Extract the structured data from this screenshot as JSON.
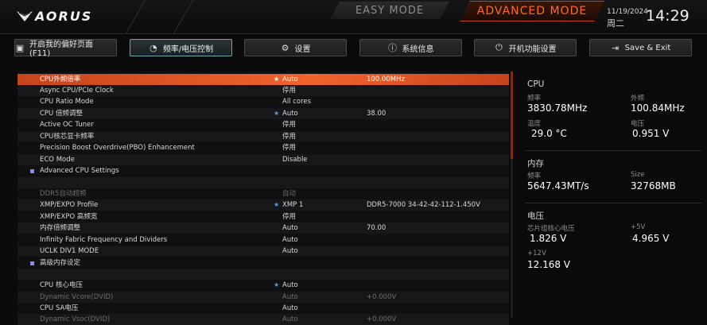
{
  "header": {
    "brand": "AORUS",
    "mode_easy": "EASY MODE",
    "mode_advanced": "ADVANCED MODE",
    "date": "11/19/2024",
    "weekday": "周二",
    "time": "14:29"
  },
  "tabs": [
    {
      "label": "开启我的偏好页面 (F11)",
      "icon": "folder-star-icon"
    },
    {
      "label": "频率/电压控制",
      "icon": "speedometer-icon"
    },
    {
      "label": "设置",
      "icon": "gear-icon"
    },
    {
      "label": "系统信息",
      "icon": "info-icon"
    },
    {
      "label": "开机功能设置",
      "icon": "power-icon"
    },
    {
      "label": "Save & Exit",
      "icon": "exit-icon"
    }
  ],
  "settings": [
    {
      "name": "CPU外频倍率",
      "value": "Auto",
      "value2": "100.00MHz",
      "star": true
    },
    {
      "name": "Async CPU/PCIe Clock",
      "value": "停用",
      "value2": ""
    },
    {
      "name": "CPU Ratio Mode",
      "value": "All cores",
      "value2": ""
    },
    {
      "name": "CPU 倍频调整",
      "value": "Auto",
      "value2": "38.00",
      "star": true
    },
    {
      "name": "Active OC Tuner",
      "value": "停用",
      "value2": ""
    },
    {
      "name": "CPU核芯显卡频率",
      "value": "停用",
      "value2": ""
    },
    {
      "name": "Precision Boost Overdrive(PBO) Enhancement",
      "value": "停用",
      "value2": ""
    },
    {
      "name": "ECO Mode",
      "value": "Disable",
      "value2": ""
    },
    {
      "name": "Advanced CPU Settings",
      "value": "",
      "value2": ""
    },
    {
      "name": "",
      "value": "",
      "value2": ""
    },
    {
      "name": "DDR5自动超频",
      "value": "自动",
      "value2": ""
    },
    {
      "name": "XMP/EXPO Profile",
      "value": "XMP 1",
      "value2": "DDR5-7000 34-42-42-112-1.450V",
      "star": true
    },
    {
      "name": "XMP/EXPO 高频宽",
      "value": "停用",
      "value2": ""
    },
    {
      "name": "内存倍频调整",
      "value": "Auto",
      "value2": "70.00"
    },
    {
      "name": "Infinity Fabric Frequency and Dividers",
      "value": "Auto",
      "value2": ""
    },
    {
      "name": "UCLK DIV1 MODE",
      "value": "Auto",
      "value2": ""
    },
    {
      "name": "高级内存设定",
      "value": "",
      "value2": ""
    },
    {
      "name": "",
      "value": "",
      "value2": ""
    },
    {
      "name": "CPU 核心电压",
      "value": "Auto",
      "value2": "",
      "star": true
    },
    {
      "name": "Dynamic Vcore(DVID)",
      "value": "Auto",
      "value2": "+0.000V"
    },
    {
      "name": "CPU SA电压",
      "value": "Auto",
      "value2": ""
    },
    {
      "name": "Dynamic Vsoc(DVID)",
      "value": "Auto",
      "value2": "+0.000V"
    }
  ],
  "info": {
    "cpu": {
      "title": "CPU",
      "freq_label": "频率",
      "freq": "3830.78MHz",
      "bclk_label": "外频",
      "bclk": "100.84MHz",
      "temp_label": "温度",
      "temp": "29.0 °C",
      "volt_label": "电压",
      "volt": "0.951 V"
    },
    "memory": {
      "title": "内存",
      "freq_label": "频率",
      "freq": "5647.43MT/s",
      "size_label": "Size",
      "size": "32768MB"
    },
    "voltage": {
      "title": "电压",
      "chipset_label": "芯片组核心电压",
      "chipset": "1.826 V",
      "p5v_label": "+5V",
      "p5v": "4.965 V",
      "p12v_label": "+12V",
      "p12v": "12.168 V"
    }
  },
  "colors": {
    "accent": "#f0642c",
    "tab_active": "#6aa6b0"
  }
}
